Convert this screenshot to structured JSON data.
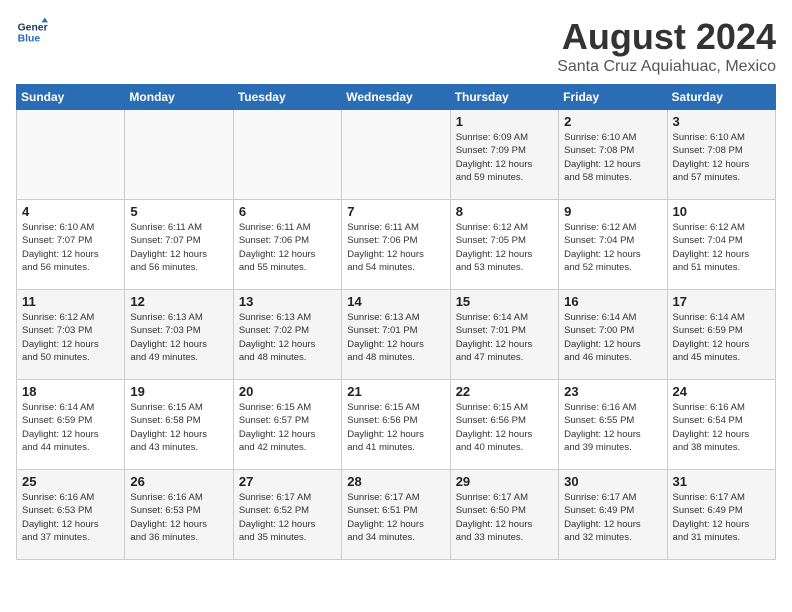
{
  "logo": {
    "line1": "General",
    "line2": "Blue"
  },
  "title": "August 2024",
  "subtitle": "Santa Cruz Aquiahuac, Mexico",
  "weekdays": [
    "Sunday",
    "Monday",
    "Tuesday",
    "Wednesday",
    "Thursday",
    "Friday",
    "Saturday"
  ],
  "weeks": [
    [
      {
        "day": "",
        "info": ""
      },
      {
        "day": "",
        "info": ""
      },
      {
        "day": "",
        "info": ""
      },
      {
        "day": "",
        "info": ""
      },
      {
        "day": "1",
        "info": "Sunrise: 6:09 AM\nSunset: 7:09 PM\nDaylight: 12 hours\nand 59 minutes."
      },
      {
        "day": "2",
        "info": "Sunrise: 6:10 AM\nSunset: 7:08 PM\nDaylight: 12 hours\nand 58 minutes."
      },
      {
        "day": "3",
        "info": "Sunrise: 6:10 AM\nSunset: 7:08 PM\nDaylight: 12 hours\nand 57 minutes."
      }
    ],
    [
      {
        "day": "4",
        "info": "Sunrise: 6:10 AM\nSunset: 7:07 PM\nDaylight: 12 hours\nand 56 minutes."
      },
      {
        "day": "5",
        "info": "Sunrise: 6:11 AM\nSunset: 7:07 PM\nDaylight: 12 hours\nand 56 minutes."
      },
      {
        "day": "6",
        "info": "Sunrise: 6:11 AM\nSunset: 7:06 PM\nDaylight: 12 hours\nand 55 minutes."
      },
      {
        "day": "7",
        "info": "Sunrise: 6:11 AM\nSunset: 7:06 PM\nDaylight: 12 hours\nand 54 minutes."
      },
      {
        "day": "8",
        "info": "Sunrise: 6:12 AM\nSunset: 7:05 PM\nDaylight: 12 hours\nand 53 minutes."
      },
      {
        "day": "9",
        "info": "Sunrise: 6:12 AM\nSunset: 7:04 PM\nDaylight: 12 hours\nand 52 minutes."
      },
      {
        "day": "10",
        "info": "Sunrise: 6:12 AM\nSunset: 7:04 PM\nDaylight: 12 hours\nand 51 minutes."
      }
    ],
    [
      {
        "day": "11",
        "info": "Sunrise: 6:12 AM\nSunset: 7:03 PM\nDaylight: 12 hours\nand 50 minutes."
      },
      {
        "day": "12",
        "info": "Sunrise: 6:13 AM\nSunset: 7:03 PM\nDaylight: 12 hours\nand 49 minutes."
      },
      {
        "day": "13",
        "info": "Sunrise: 6:13 AM\nSunset: 7:02 PM\nDaylight: 12 hours\nand 48 minutes."
      },
      {
        "day": "14",
        "info": "Sunrise: 6:13 AM\nSunset: 7:01 PM\nDaylight: 12 hours\nand 48 minutes."
      },
      {
        "day": "15",
        "info": "Sunrise: 6:14 AM\nSunset: 7:01 PM\nDaylight: 12 hours\nand 47 minutes."
      },
      {
        "day": "16",
        "info": "Sunrise: 6:14 AM\nSunset: 7:00 PM\nDaylight: 12 hours\nand 46 minutes."
      },
      {
        "day": "17",
        "info": "Sunrise: 6:14 AM\nSunset: 6:59 PM\nDaylight: 12 hours\nand 45 minutes."
      }
    ],
    [
      {
        "day": "18",
        "info": "Sunrise: 6:14 AM\nSunset: 6:59 PM\nDaylight: 12 hours\nand 44 minutes."
      },
      {
        "day": "19",
        "info": "Sunrise: 6:15 AM\nSunset: 6:58 PM\nDaylight: 12 hours\nand 43 minutes."
      },
      {
        "day": "20",
        "info": "Sunrise: 6:15 AM\nSunset: 6:57 PM\nDaylight: 12 hours\nand 42 minutes."
      },
      {
        "day": "21",
        "info": "Sunrise: 6:15 AM\nSunset: 6:56 PM\nDaylight: 12 hours\nand 41 minutes."
      },
      {
        "day": "22",
        "info": "Sunrise: 6:15 AM\nSunset: 6:56 PM\nDaylight: 12 hours\nand 40 minutes."
      },
      {
        "day": "23",
        "info": "Sunrise: 6:16 AM\nSunset: 6:55 PM\nDaylight: 12 hours\nand 39 minutes."
      },
      {
        "day": "24",
        "info": "Sunrise: 6:16 AM\nSunset: 6:54 PM\nDaylight: 12 hours\nand 38 minutes."
      }
    ],
    [
      {
        "day": "25",
        "info": "Sunrise: 6:16 AM\nSunset: 6:53 PM\nDaylight: 12 hours\nand 37 minutes."
      },
      {
        "day": "26",
        "info": "Sunrise: 6:16 AM\nSunset: 6:53 PM\nDaylight: 12 hours\nand 36 minutes."
      },
      {
        "day": "27",
        "info": "Sunrise: 6:17 AM\nSunset: 6:52 PM\nDaylight: 12 hours\nand 35 minutes."
      },
      {
        "day": "28",
        "info": "Sunrise: 6:17 AM\nSunset: 6:51 PM\nDaylight: 12 hours\nand 34 minutes."
      },
      {
        "day": "29",
        "info": "Sunrise: 6:17 AM\nSunset: 6:50 PM\nDaylight: 12 hours\nand 33 minutes."
      },
      {
        "day": "30",
        "info": "Sunrise: 6:17 AM\nSunset: 6:49 PM\nDaylight: 12 hours\nand 32 minutes."
      },
      {
        "day": "31",
        "info": "Sunrise: 6:17 AM\nSunset: 6:49 PM\nDaylight: 12 hours\nand 31 minutes."
      }
    ]
  ]
}
